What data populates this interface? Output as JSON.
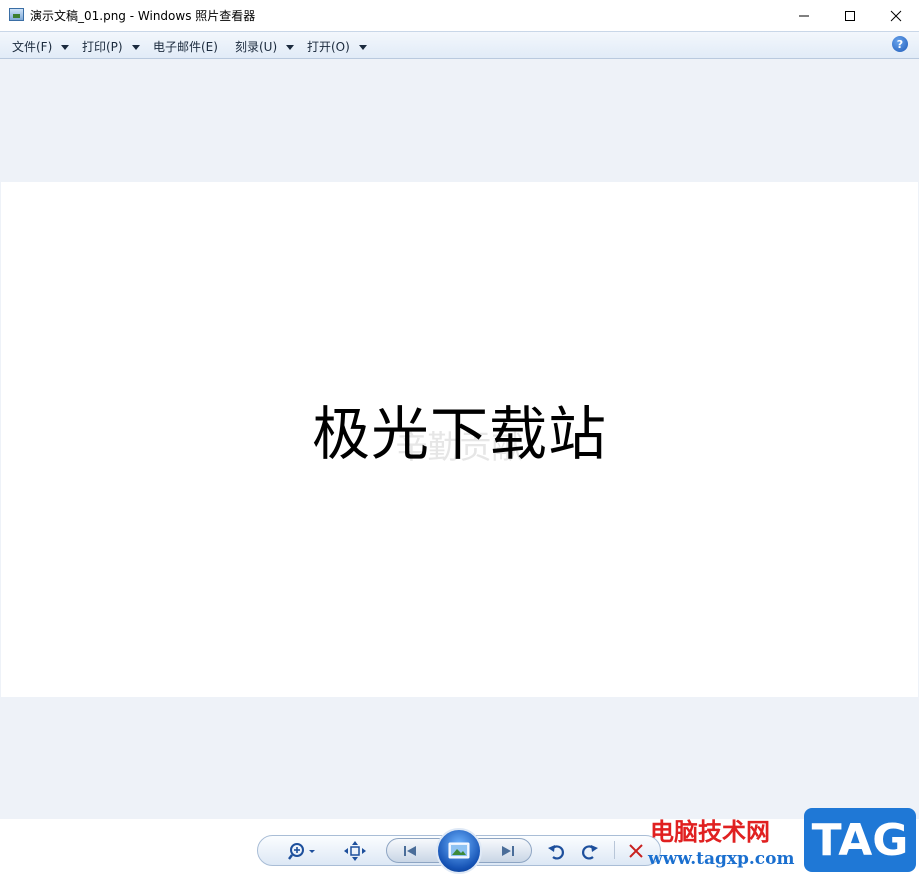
{
  "window": {
    "title": "演示文稿_01.png - Windows 照片查看器"
  },
  "menu": {
    "items": [
      {
        "label": "文件(F)",
        "has_dropdown": true
      },
      {
        "label": "打印(P)",
        "has_dropdown": true
      },
      {
        "label": "电子邮件(E)",
        "has_dropdown": false
      },
      {
        "label": "刻录(U)",
        "has_dropdown": true
      },
      {
        "label": "打开(O)",
        "has_dropdown": true
      }
    ],
    "help_label": "?"
  },
  "image": {
    "main_text": "极光下载站",
    "ghost_text": "辛勤贡献"
  },
  "toolbar": {
    "icons": [
      "zoom-icon",
      "fit-window-icon",
      "previous-icon",
      "slideshow-icon",
      "next-icon",
      "rotate-left-icon",
      "rotate-right-icon",
      "delete-icon"
    ]
  },
  "watermark": {
    "title": "电脑技术网",
    "url": "www.tagxp.com",
    "badge": "TAG"
  },
  "colors": {
    "viewer_bg": "#eef2f8",
    "menubar_bg": "#e1ebf7",
    "delete": "#c8201e",
    "watermark_red": "#e02020",
    "watermark_blue": "#1f78d6"
  }
}
